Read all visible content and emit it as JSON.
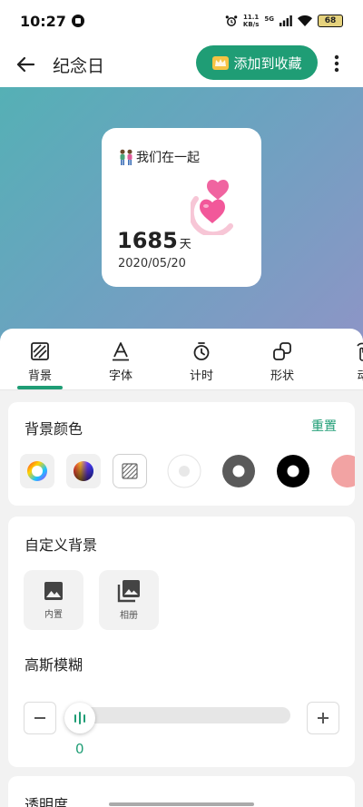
{
  "status_bar": {
    "time": "10:27",
    "net_speed_value": "11.1",
    "net_speed_unit": "KB/s",
    "network": "5G",
    "battery": "68"
  },
  "app_bar": {
    "title": "纪念日",
    "favorite_label": "添加到收藏"
  },
  "preview_card": {
    "title": "我们在一起",
    "days": "1685",
    "days_unit": "天",
    "date": "2020/05/20"
  },
  "tabs": [
    {
      "label": "背景",
      "icon": "background-pattern-icon",
      "selected": true
    },
    {
      "label": "字体",
      "icon": "font-a-icon"
    },
    {
      "label": "计时",
      "icon": "timer-icon"
    },
    {
      "label": "形状",
      "icon": "shape-icon"
    },
    {
      "label": "动",
      "icon": "motion-icon"
    }
  ],
  "background_color": {
    "title": "背景颜色",
    "reset_label": "重置",
    "swatches": [
      "color-wheel-icon",
      "color-spectrum-icon",
      "pattern-icon",
      "#ffffff",
      "#5a5a5a",
      "#000000",
      "#f2a3a3"
    ]
  },
  "custom_background": {
    "title": "自定义背景",
    "builtin_label": "内置",
    "album_label": "相册",
    "blur_title": "高斯模糊",
    "blur_value": "0",
    "blur_level": 0
  },
  "opacity": {
    "title": "透明度"
  },
  "colors": {
    "accent": "#1f9d75"
  }
}
